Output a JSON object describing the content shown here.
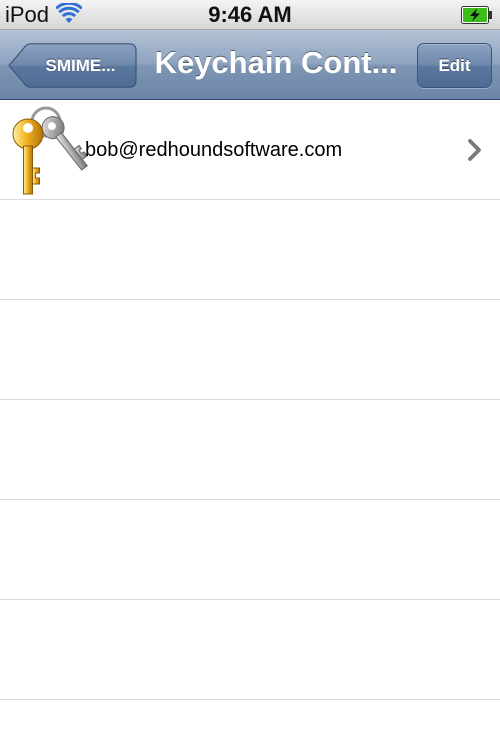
{
  "status_bar": {
    "carrier": "iPod",
    "time": "9:46 AM",
    "wifi_icon": "wifi-icon",
    "battery_icon": "battery-charging-icon",
    "battery_color": "#3cbd1a"
  },
  "nav_bar": {
    "back_label": "SMIME...",
    "title": "Keychain Cont...",
    "edit_label": "Edit",
    "bar_color": "#7f95b3"
  },
  "table": {
    "rows": [
      {
        "label": "bob@redhoundsoftware.com",
        "icon": "keys-icon",
        "accessory": "chevron-right-icon"
      },
      {
        "label": ""
      },
      {
        "label": ""
      },
      {
        "label": ""
      },
      {
        "label": ""
      },
      {
        "label": ""
      }
    ]
  }
}
